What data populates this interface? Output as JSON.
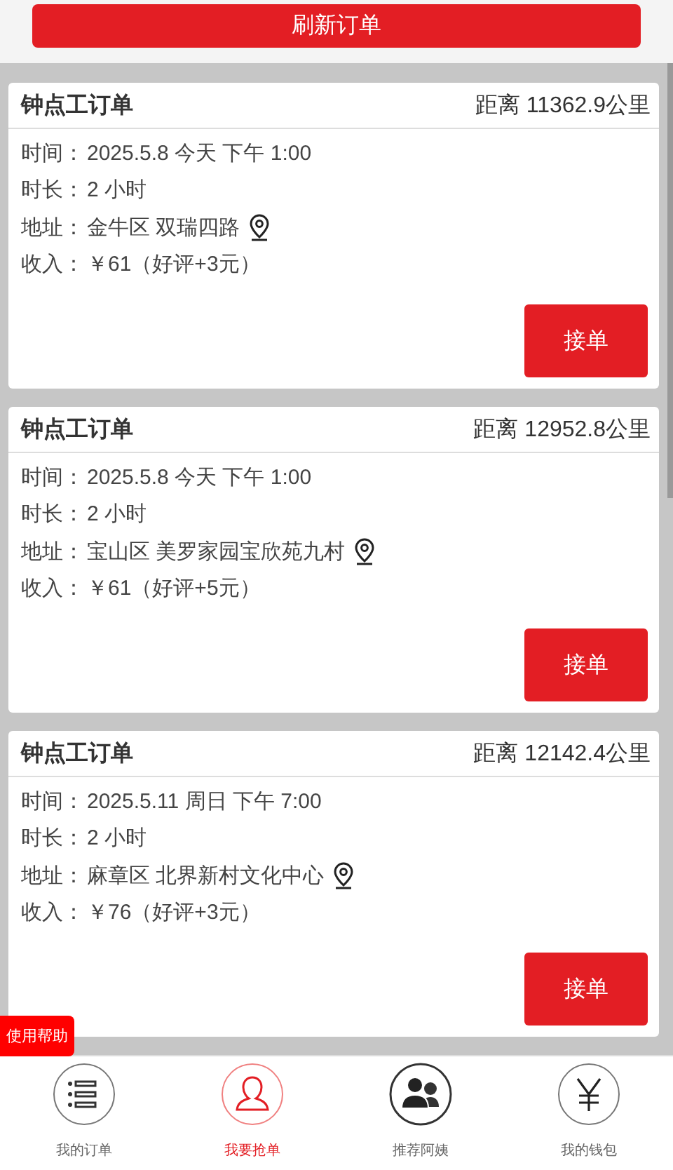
{
  "refresh_button": "刷新订单",
  "orders": [
    {
      "title": "钟点工订单",
      "distance": "距离 11362.9公里",
      "rows": [
        {
          "label": "时间：",
          "value": "2025.5.8 今天 下午 1:00"
        },
        {
          "label": "时长：",
          "value": "2 小时"
        },
        {
          "label": "地址：",
          "value": "金牛区 双瑞四路",
          "kind": "address"
        },
        {
          "label": "收入：",
          "value": "￥61（好评+3元）"
        }
      ],
      "accept": "接单"
    },
    {
      "title": "钟点工订单",
      "distance": "距离 12952.8公里",
      "rows": [
        {
          "label": "时间：",
          "value": "2025.5.8 今天 下午 1:00"
        },
        {
          "label": "时长：",
          "value": "2 小时"
        },
        {
          "label": "地址：",
          "value": "宝山区 美罗家园宝欣苑九村",
          "kind": "address"
        },
        {
          "label": "收入：",
          "value": "￥61（好评+5元）"
        }
      ],
      "accept": "接单"
    },
    {
      "title": "钟点工订单",
      "distance": "距离 12142.4公里",
      "rows": [
        {
          "label": "时间：",
          "value": "2025.5.11 周日 下午 7:00"
        },
        {
          "label": "时长：",
          "value": "2 小时"
        },
        {
          "label": "地址：",
          "value": "麻章区 北界新村文化中心",
          "kind": "address"
        },
        {
          "label": "收入：",
          "value": "￥76（好评+3元）"
        }
      ],
      "accept": "接单"
    }
  ],
  "help_button": "使用帮助",
  "nav": [
    {
      "label": "我的订单",
      "kind": "list",
      "selected": false
    },
    {
      "label": "我要抢单",
      "kind": "person",
      "selected": true
    },
    {
      "label": "推荐阿姨",
      "kind": "people",
      "selected": false
    },
    {
      "label": "我的钱包",
      "kind": "wallet",
      "selected": false
    }
  ]
}
